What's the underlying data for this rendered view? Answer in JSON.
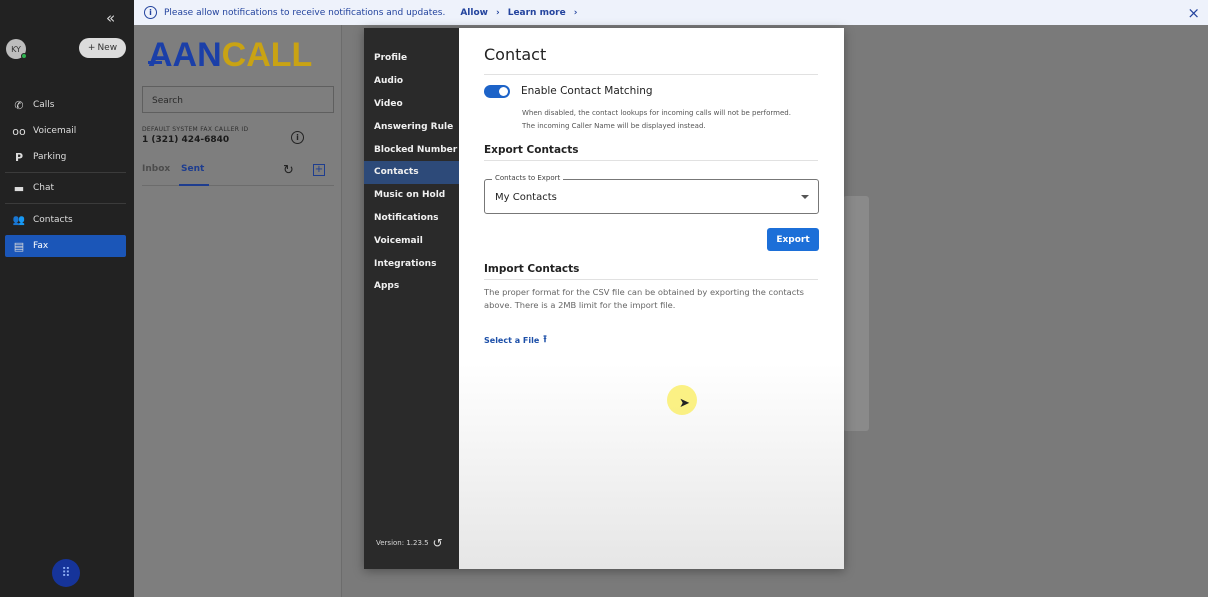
{
  "rail": {
    "collapse": "«",
    "avatar": "KY",
    "new_label": "New",
    "nav": [
      {
        "icon": "phone-icon",
        "glyph": "✆",
        "label": "Calls"
      },
      {
        "icon": "voicemail-icon",
        "glyph": "oo",
        "label": "Voicemail"
      },
      {
        "icon": "parking-icon",
        "glyph": "P",
        "label": "Parking"
      },
      {
        "icon": "chat-icon",
        "glyph": "▬",
        "label": "Chat"
      },
      {
        "icon": "contacts-icon",
        "glyph": "👥",
        "label": "Contacts"
      },
      {
        "icon": "fax-icon",
        "glyph": "▤",
        "label": "Fax"
      }
    ],
    "active": "Fax",
    "dialer": "⠿"
  },
  "banner": {
    "message": "Please allow notifications to receive notifications and updates.",
    "allow": "Allow",
    "learn_more": "Learn more",
    "close": "×"
  },
  "fax": {
    "logo_a": "AAN",
    "logo_b": "CALL",
    "search_placeholder": "Search",
    "caller_id_caption": "DEFAULT SYSTEM FAX CALLER ID",
    "caller_id": "1 (321) 424-6840",
    "tab_inbox": "Inbox",
    "tab_sent": "Sent",
    "active_tab": "Sent"
  },
  "modal": {
    "sidebar": [
      "Profile",
      "Audio",
      "Video",
      "Answering Rule",
      "Blocked Number",
      "Contacts",
      "Music on Hold",
      "Notifications",
      "Voicemail",
      "Integrations",
      "Apps"
    ],
    "active": "Contacts",
    "version": "Version: 1.23.5",
    "title": "Contact",
    "toggle_label": "Enable Contact Matching",
    "toggle_on": true,
    "toggle_help_1": "When disabled, the contact lookups for incoming calls will not be performed.",
    "toggle_help_2": "The incoming Caller Name will be displayed instead.",
    "export_heading": "Export Contacts",
    "select_label": "Contacts to Export",
    "select_value": "My Contacts",
    "export_button": "Export",
    "import_heading": "Import Contacts",
    "import_desc": "The proper format for the CSV file can be obtained by exporting the contacts above. There is a 2MB limit for the import file.",
    "select_file": "Select a File"
  },
  "colors": {
    "accent": "#1d63c8",
    "rail": "#222222",
    "active_nav": "#1b56b8",
    "logo_blue": "#1b3fa8",
    "logo_gold": "#c9a313"
  }
}
